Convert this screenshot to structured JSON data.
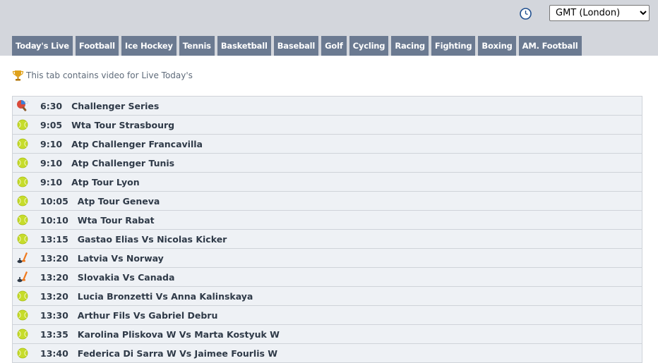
{
  "timezone": {
    "selected": "GMT (London)"
  },
  "tabs": [
    "Today's Live",
    "Football",
    "Ice Hockey",
    "Tennis",
    "Basketball",
    "Baseball",
    "Golf",
    "Cycling",
    "Racing",
    "Fighting",
    "Boxing",
    "AM. Football"
  ],
  "notice": "This tab contains video for Live Today's",
  "events": [
    {
      "time": "6:30",
      "name": "Challenger Series",
      "sport": "table-tennis"
    },
    {
      "time": "9:05",
      "name": "Wta Tour Strasbourg",
      "sport": "tennis"
    },
    {
      "time": "9:10",
      "name": "Atp Challenger Francavilla",
      "sport": "tennis"
    },
    {
      "time": "9:10",
      "name": "Atp Challenger Tunis",
      "sport": "tennis"
    },
    {
      "time": "9:10",
      "name": "Atp Tour Lyon",
      "sport": "tennis"
    },
    {
      "time": "10:05",
      "name": "Atp Tour Geneva",
      "sport": "tennis"
    },
    {
      "time": "10:10",
      "name": "Wta Tour Rabat",
      "sport": "tennis"
    },
    {
      "time": "13:15",
      "name": "Gastao Elias Vs Nicolas Kicker",
      "sport": "tennis"
    },
    {
      "time": "13:20",
      "name": "Latvia Vs Norway",
      "sport": "ice-hockey"
    },
    {
      "time": "13:20",
      "name": "Slovakia Vs Canada",
      "sport": "ice-hockey"
    },
    {
      "time": "13:20",
      "name": "Lucia Bronzetti Vs Anna Kalinskaya",
      "sport": "tennis"
    },
    {
      "time": "13:30",
      "name": "Arthur Fils Vs Gabriel Debru",
      "sport": "tennis"
    },
    {
      "time": "13:35",
      "name": "Karolina Pliskova W Vs Marta Kostyuk W",
      "sport": "tennis"
    },
    {
      "time": "13:40",
      "name": "Federica Di Sarra W Vs Jaimee Fourlis W",
      "sport": "tennis"
    }
  ],
  "colors": {
    "tab_bg": "#6b7a91",
    "topbar_bg": "#d3d6dc",
    "row_bg": "#eef1f5",
    "tennis_ball": "#c6dc2a"
  }
}
